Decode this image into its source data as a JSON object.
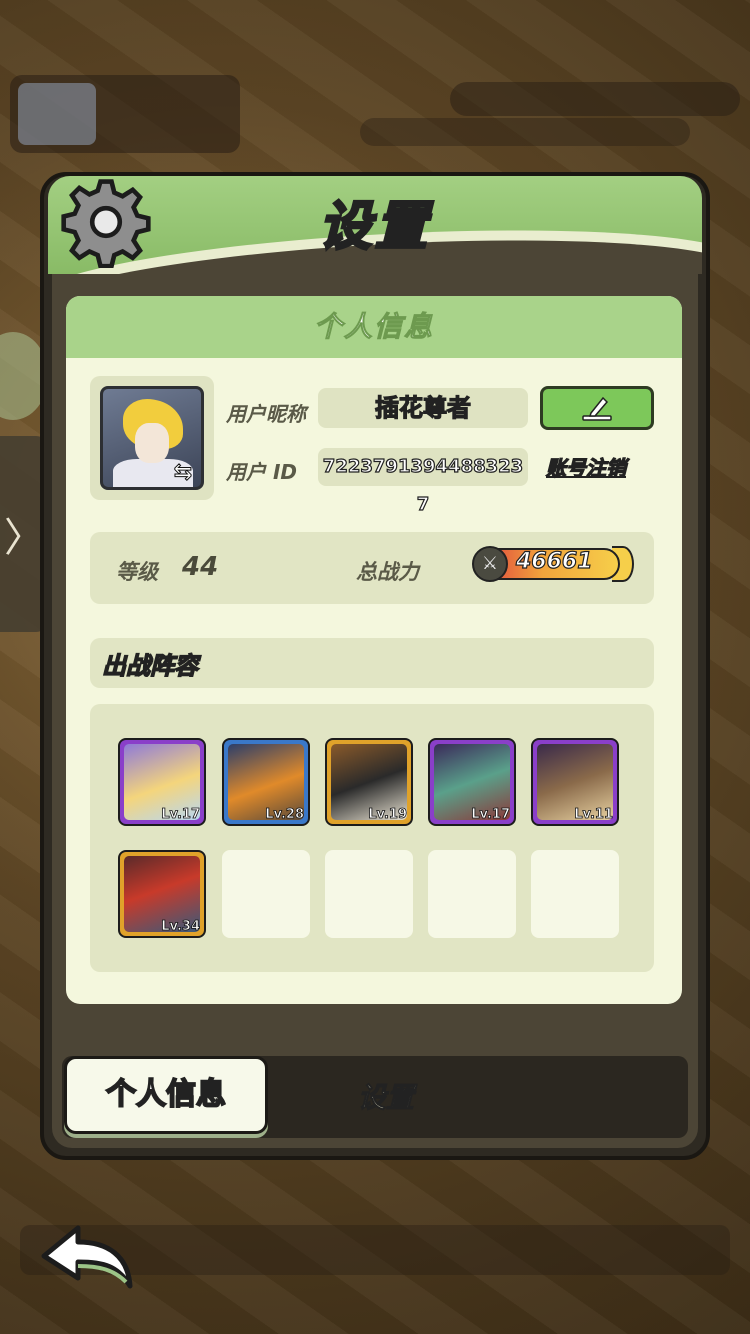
{
  "header": {
    "title": "设置"
  },
  "card": {
    "title": "个人信息",
    "nickname_label": "用户昵称",
    "nickname_value": "插花尊者",
    "id_label": "用户  ID",
    "id_value": "7223791394488323​7",
    "logout_label": "账号注销"
  },
  "stats": {
    "level_label": "等级",
    "level_value": "44",
    "power_label": "总战力",
    "power_value": "46661"
  },
  "team": {
    "title": "出战阵容",
    "slots": [
      {
        "lv": "Lv.17",
        "frame": "#8a3fc9",
        "art": "linear-gradient(160deg,#8f7ad8,#f4d57c 55%,#b8d6f2)"
      },
      {
        "lv": "Lv.28",
        "frame": "#3a78c9",
        "art": "linear-gradient(160deg,#2c3e6a,#e08a2a 55%,#5a4a3a)"
      },
      {
        "lv": "Lv.19",
        "frame": "#e0a22a",
        "art": "linear-gradient(160deg,#8a5a2a,#2a2a2a 50%,#e6e0d0)"
      },
      {
        "lv": "Lv.17",
        "frame": "#8a3fc9",
        "art": "linear-gradient(160deg,#3a2a5a,#5aa08a 50%,#8a3a3a)"
      },
      {
        "lv": "Lv.11",
        "frame": "#8a3fc9",
        "art": "linear-gradient(160deg,#3a2a4a,#8a6a4a 50%,#e6d0a0)"
      },
      {
        "lv": "Lv.34",
        "frame": "#e0a22a",
        "art": "linear-gradient(160deg,#5a2a2a,#c83a2a 45%,#3a5a7a)"
      }
    ]
  },
  "tabs": {
    "active": "个人信息",
    "idle": "设置"
  },
  "side": {
    "arrow": "〉"
  },
  "colors": {
    "accent_green": "#a9d38a",
    "panel_bg": "#f4f7dd",
    "button_green": "#7dc85a"
  }
}
